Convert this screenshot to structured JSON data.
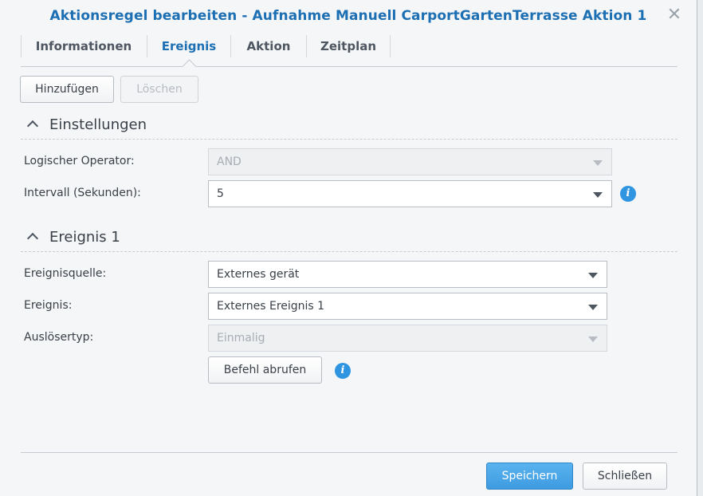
{
  "dialog": {
    "title": "Aktionsregel bearbeiten - Aufnahme Manuell CarportGartenTerrasse Aktion 1",
    "close_glyph": "✕"
  },
  "tabs": [
    {
      "label": "Informationen",
      "active": false
    },
    {
      "label": "Ereignis",
      "active": true
    },
    {
      "label": "Aktion",
      "active": false
    },
    {
      "label": "Zeitplan",
      "active": false
    }
  ],
  "toolbar": {
    "add_label": "Hinzufügen",
    "delete_label": "Löschen"
  },
  "settings": {
    "heading": "Einstellungen",
    "logical_operator": {
      "label": "Logischer Operator:",
      "value": "AND",
      "disabled": true
    },
    "interval": {
      "label": "Intervall (Sekunden):",
      "value": "5"
    }
  },
  "event1": {
    "heading": "Ereignis 1",
    "source": {
      "label": "Ereignisquelle:",
      "value": "Externes gerät"
    },
    "event": {
      "label": "Ereignis:",
      "value": "Externes Ereignis 1"
    },
    "trigger_type": {
      "label": "Auslösertyp:",
      "value": "Einmalig",
      "disabled": true
    },
    "fetch_command_label": "Befehl abrufen"
  },
  "icons": {
    "info": "info-icon",
    "close": "close-icon",
    "caret": "chevron-down-icon",
    "collapse": "chevron-up-icon"
  },
  "footer": {
    "save_label": "Speichern",
    "close_label": "Schließen"
  },
  "colors": {
    "accent": "#1d6fb4",
    "primary_button": "#3e9be0",
    "info_icon": "#2f95e0"
  }
}
